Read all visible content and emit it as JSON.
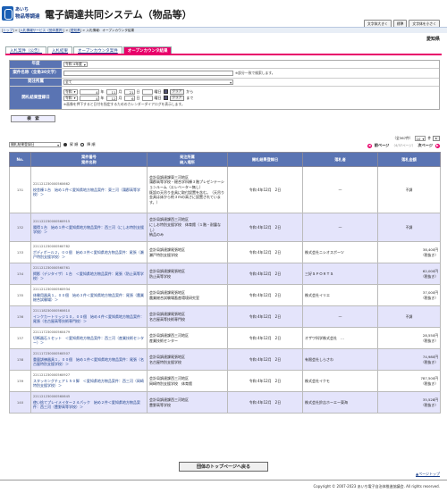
{
  "header": {
    "logo_line1": "あいち",
    "logo_line2": "物品等調達",
    "title": "電子調達共同システム（物品等）",
    "buttons": [
      "文字体大きく",
      "標準",
      "文字体を小さく"
    ]
  },
  "breadcrumb": {
    "items": [
      "トップ",
      "入札情報サービス（団体選択）",
      "愛知県",
      "入札情報：オープンカウンタ結果"
    ]
  },
  "organization": "愛知県",
  "tabs": [
    "入札案件（公告）",
    "入札結果",
    "オープンカウンタ案件",
    "オープンカウンタ結果"
  ],
  "search": {
    "fiscal_year_label": "年度",
    "fiscal_year_value": "令和 4年度",
    "case_name_label": "案件名称（全角30文字）",
    "case_name_note": "※部分一致で検索します。",
    "office_label": "発注所属",
    "office_value": "全て",
    "date_label": "開札結果登録日",
    "from": {
      "era": "令和",
      "y": "4",
      "m": "11",
      "d": "21",
      "clear": "クリア",
      "suffix": "から",
      "dow": "曜日"
    },
    "to": {
      "era": "令和",
      "y": "4",
      "m": "12",
      "d": "6",
      "clear": "クリア",
      "suffix": "まで",
      "dow": "曜日"
    },
    "calendar_note": "※画像を押下すると日付を指定するためのカレンダーダイアログを表示します。",
    "search_button": "検　索"
  },
  "controls": {
    "sort_value": "開札結果登録日",
    "asc": "昇 順",
    "desc": "降 順",
    "count_text": "（全367件）",
    "per_page": "10",
    "per_page_unit": "件",
    "prev": "前ページ",
    "page_info": "（4/37ページ）",
    "next": "次ページ"
  },
  "table": {
    "headers": [
      "No.",
      "案件番号\n案件名称",
      "発注所属\n納入場所",
      "開札結果登録日",
      "落札者",
      "落札金額"
    ],
    "rows": [
      {
        "no": "131",
        "id": "221121230000560662",
        "name": "校舎棟１台　始め１件＜愛知県地方物品案件：東三河（蒲郡高等学校）＞",
        "office": "会計局調達課東三河地区\n蒲郡高等学校・総合学科棟３階プレゼンテーションルーム（エレベーター無し）\n既設の天吊り金具に取付設置を含む。（天吊り金具は床から約３ｍの高さに設置されています。）",
        "date": "令和 4年12月　2日",
        "winner": "—",
        "amount": "不調",
        "hl": false
      },
      {
        "no": "132",
        "id": "221122230000560915",
        "name": "陽得１台　始め１件＜愛知県地方物品案件：西三河（にしお特別支援学校）＞",
        "office": "会計局調達課西三河地区\nにしお特別支援学校　体育館（１階・耐震なし）\n納品のみ",
        "date": "令和 4年12月　2日",
        "winner": "—",
        "amount": "不調",
        "hl": true
      },
      {
        "no": "133",
        "id": "221121230000560782",
        "name": "ポディボール２，００個　始め３件＜愛知県地方物品案件：尾張（瀬戸特別支援学校）＞",
        "office": "会計局調達課尾張地区\n瀬戸特別支援学校",
        "date": "令和 4年12月　2日",
        "winner": "株式会社ニシオスポーツ",
        "amount": "38,400円\n（税抜き）",
        "hl": false
      },
      {
        "no": "134",
        "id": "221121230000560761",
        "name": "掲影（デジタイザ）１台　＜愛知県地方物品案件：尾張（防止高等学校）＞",
        "office": "会計局調達課尾張地区\n防止高等学校",
        "date": "令和 4年12月　2日",
        "winner": "三好ＳＰＯＲＴＳ",
        "amount": "62,000円\n（税抜き）",
        "hl": true
      },
      {
        "no": "135",
        "id": "221121230000560934",
        "name": "体験用器具１，００個　始め３件＜愛知県地方物品案件：尾張（農業総合試験場）＞",
        "office": "会計局調達課尾張地区\n農業総合試験場畜産環境研究室",
        "date": "令和 4年12月　2日",
        "winner": "株式会社イリエ",
        "amount": "37,000円\n（税抜き）",
        "hl": false
      },
      {
        "no": "136",
        "id": "221118230000560610",
        "name": "インクカートリッジ１０，００個　始め４件＜愛知県地方物品案件：尾張（名古屋高等技術専門校）＞",
        "office": "会計局調達課尾張地区\n名古屋高等技術専門校",
        "date": "令和 4年12月　2日",
        "winner": "—",
        "amount": "不調",
        "hl": true
      },
      {
        "no": "137",
        "id": "221117230000560479",
        "name": "切断器石１セット　＜愛知県地方物品案件：西三河（産業技術センター）＞",
        "office": "会計局調達課西三河地区\n産業技術センター",
        "date": "令和 4年12月　2日",
        "winner": "オザワ科学株式会社　…",
        "amount": "28,550円\n（税抜き）",
        "hl": false
      },
      {
        "no": "138",
        "id": "221117230000560507",
        "name": "重量訓練器具１，００個　始め１件＜愛知県地方物品案件：尾張（名古屋特別支援学校）＞",
        "office": "会計局調達課尾張地区\n名古屋特別支援学校",
        "date": "令和 4年12月　2日",
        "winner": "有限会社しらさわ",
        "amount": "74,980円\n（税抜き）",
        "hl": true
      },
      {
        "no": "139",
        "id": "221121230000560927",
        "name": "スタッキングチェア１５０脚　＜愛知県地方物品案件：西三河（岡崎特別支援学校）＞",
        "office": "会計局調達課西三河地区\n岡崎特別支援学校　体育館",
        "date": "令和 4年12月　2日",
        "winner": "株式会社イクモ",
        "amount": "787,500円\n（税抜き）",
        "hl": false
      },
      {
        "no": "140",
        "id": "221121230000560645",
        "name": "使い捨てプレイメイター２４パック　始め２件＜愛知県地方物品案件：西三河（豊野高等学校）＞",
        "office": "会計局調達課西三河地区\n豊野高等学校",
        "date": "令和 4年12月　2日",
        "winner": "株式会社鈴吉ホーエー東海",
        "amount": "35,528円\n（税抜き）",
        "hl": true
      }
    ]
  },
  "back_button": "団体のトップページへ戻る",
  "page_top": "▲ページトップ",
  "footer": "Copyright © 2007-2023 あいち電子自治体推進協議会. All rights reserved."
}
